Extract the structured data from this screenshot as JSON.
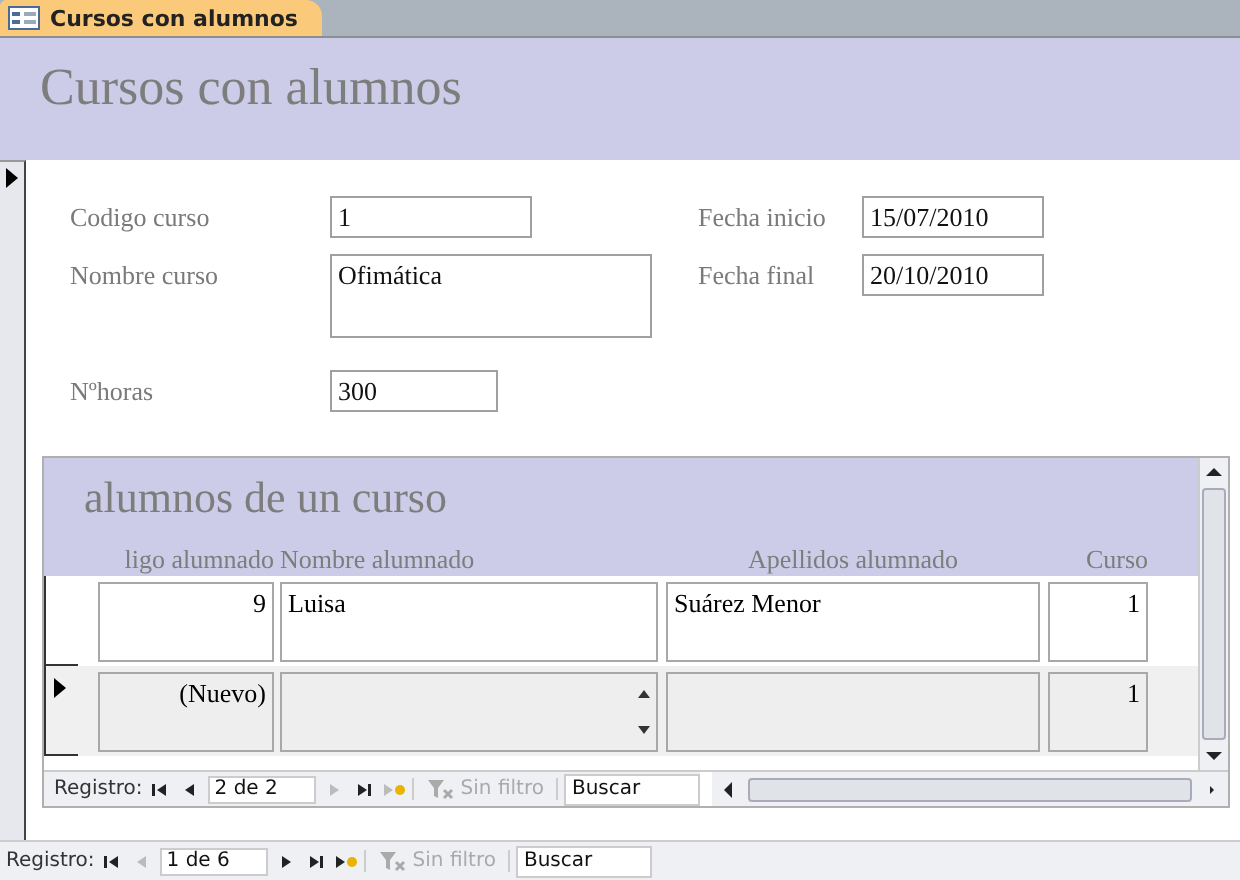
{
  "tab": {
    "label": "Cursos con alumnos",
    "selected": true
  },
  "header": {
    "title": "Cursos con alumnos"
  },
  "form": {
    "record_selected": true,
    "fields": [
      {
        "label": "Codigo curso",
        "value": "1",
        "kind": "short"
      },
      {
        "label": "Fecha inicio",
        "value": "15/07/2010",
        "kind": "date"
      },
      {
        "label": "Nombre curso",
        "value": "Ofimática",
        "kind": "tall"
      },
      {
        "label": "Fecha final",
        "value": "20/10/2010",
        "kind": "date"
      },
      {
        "label": "Nºhoras",
        "value": "300",
        "kind": "medium"
      }
    ]
  },
  "subform": {
    "title": "alumnos de un curso",
    "columns": [
      "ligo alumnado",
      "Nombre alumnado",
      "Apellidos alumnado",
      "Curso"
    ],
    "rows": [
      {
        "kind": "record",
        "selected": false,
        "cells": [
          "9",
          "Luisa",
          "Suárez Menor",
          "1"
        ]
      },
      {
        "kind": "new",
        "selected": true,
        "cells": [
          "(Nuevo)",
          "",
          "",
          "1"
        ]
      }
    ],
    "nav": {
      "label": "Registro:",
      "buttons": [
        {
          "kind": "first",
          "disabled": false
        },
        {
          "kind": "prev",
          "disabled": false
        },
        {
          "kind": "position",
          "text": "2 de 2"
        },
        {
          "kind": "next",
          "disabled": true
        },
        {
          "kind": "last",
          "disabled": false
        },
        {
          "kind": "new",
          "disabled": true
        }
      ],
      "filter": {
        "label": "Sin filtro",
        "disabled": true
      },
      "search": {
        "placeholder": "Buscar"
      }
    }
  },
  "nav": {
    "label": "Registro:",
    "buttons": [
      {
        "kind": "first",
        "disabled": false
      },
      {
        "kind": "prev",
        "disabled": true
      },
      {
        "kind": "position",
        "text": "1 de 6"
      },
      {
        "kind": "next",
        "disabled": false
      },
      {
        "kind": "last",
        "disabled": false
      },
      {
        "kind": "new",
        "disabled": false
      }
    ],
    "filter": {
      "label": "Sin filtro",
      "disabled": true
    },
    "search": {
      "placeholder": "Buscar"
    }
  }
}
